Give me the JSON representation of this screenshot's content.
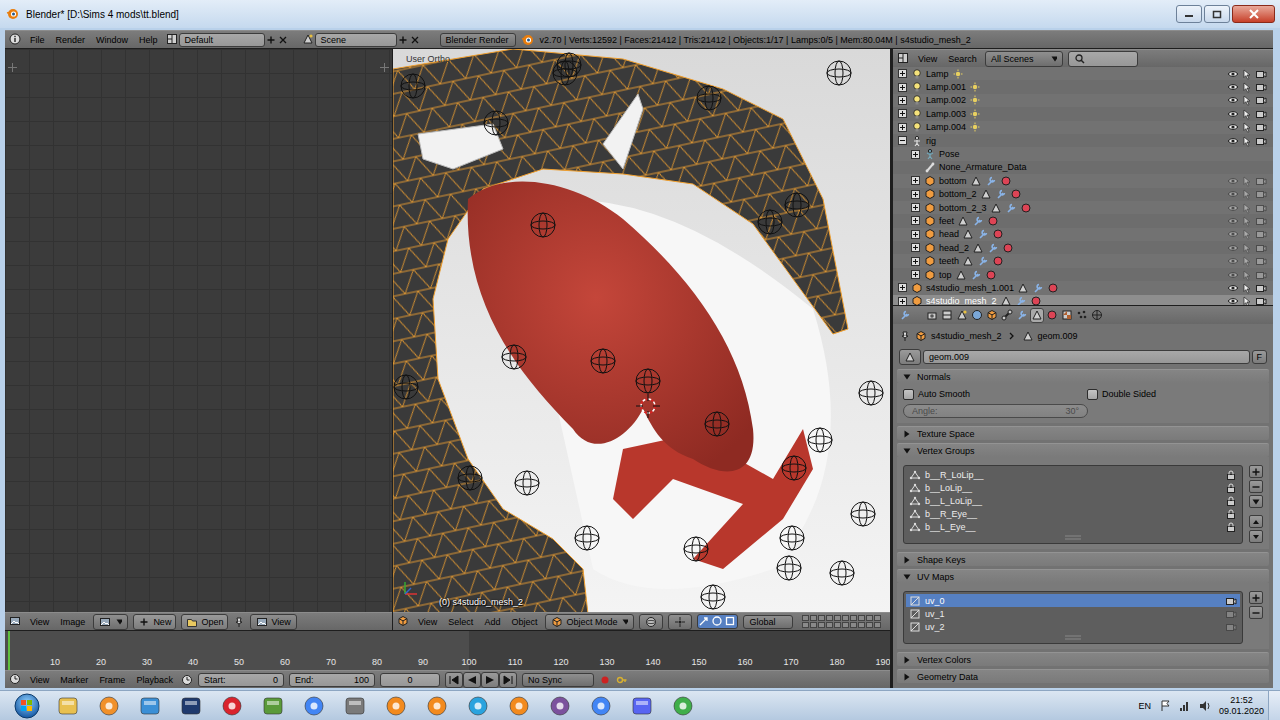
{
  "window": {
    "title": "Blender* [D:\\Sims 4 mods\\tt.blend]"
  },
  "info_header": {
    "menus": [
      "File",
      "Render",
      "Window",
      "Help"
    ],
    "layout": "Default",
    "scene": "Scene",
    "engine": "Blender Render",
    "stats": "v2.70 | Verts:12592 | Faces:21412 | Tris:21412 | Objects:1/17 | Lamps:0/5 | Mem:80.04M | s4studio_mesh_2"
  },
  "image_editor": {
    "menus": [
      "View",
      "Image"
    ],
    "buttons": [
      "New",
      "Open"
    ],
    "view_menu": "View"
  },
  "viewport": {
    "view_label": "User Ortho",
    "object_label": "(0) s4studio_mesh_2",
    "menus": [
      "View",
      "Select",
      "Add",
      "Object"
    ],
    "mode": "Object Mode",
    "orientation": "Global"
  },
  "outliner": {
    "menus": [
      "View",
      "Search"
    ],
    "filter": "All Scenes",
    "items": [
      {
        "label": "Lamp",
        "kind": "lamp",
        "depth": 1,
        "has_children": true,
        "expanded": false,
        "selected": false
      },
      {
        "label": "Lamp.001",
        "kind": "lamp",
        "depth": 1,
        "has_children": true,
        "expanded": false,
        "selected": false
      },
      {
        "label": "Lamp.002",
        "kind": "lamp",
        "depth": 1,
        "has_children": true,
        "expanded": false,
        "selected": false
      },
      {
        "label": "Lamp.003",
        "kind": "lamp",
        "depth": 1,
        "has_children": true,
        "expanded": false,
        "selected": false
      },
      {
        "label": "Lamp.004",
        "kind": "lamp",
        "depth": 1,
        "has_children": true,
        "expanded": false,
        "selected": false
      },
      {
        "label": "rig",
        "kind": "armature",
        "depth": 1,
        "has_children": true,
        "expanded": true,
        "selected": false
      },
      {
        "label": "Pose",
        "kind": "pose",
        "depth": 2,
        "has_children": true,
        "expanded": false,
        "selected": false
      },
      {
        "label": "None_Armature_Data",
        "kind": "armature-data",
        "depth": 2,
        "has_children": false,
        "expanded": false,
        "selected": false
      },
      {
        "label": "bottom",
        "kind": "mesh",
        "depth": 2,
        "has_children": true,
        "expanded": false,
        "selected": false
      },
      {
        "label": "bottom_2",
        "kind": "mesh",
        "depth": 2,
        "has_children": true,
        "expanded": false,
        "selected": false
      },
      {
        "label": "bottom_2_3",
        "kind": "mesh",
        "depth": 2,
        "has_children": true,
        "expanded": false,
        "selected": false
      },
      {
        "label": "feet",
        "kind": "mesh",
        "depth": 2,
        "has_children": true,
        "expanded": false,
        "selected": false
      },
      {
        "label": "head",
        "kind": "mesh",
        "depth": 2,
        "has_children": true,
        "expanded": false,
        "selected": false
      },
      {
        "label": "head_2",
        "kind": "mesh",
        "depth": 2,
        "has_children": true,
        "expanded": false,
        "selected": false
      },
      {
        "label": "teeth",
        "kind": "mesh",
        "depth": 2,
        "has_children": true,
        "expanded": false,
        "selected": false
      },
      {
        "label": "top",
        "kind": "mesh",
        "depth": 2,
        "has_children": true,
        "expanded": false,
        "selected": false
      },
      {
        "label": "s4studio_mesh_1.001",
        "kind": "mesh",
        "depth": 1,
        "has_children": true,
        "expanded": false,
        "selected": false
      },
      {
        "label": "s4studio_mesh_2",
        "kind": "mesh",
        "depth": 1,
        "has_children": true,
        "expanded": false,
        "selected": true
      }
    ]
  },
  "properties": {
    "tabs": [
      {
        "kind": "render",
        "selected": false
      },
      {
        "kind": "render-layers",
        "selected": false
      },
      {
        "kind": "scene",
        "selected": false
      },
      {
        "kind": "world",
        "selected": false
      },
      {
        "kind": "object",
        "selected": false
      },
      {
        "kind": "constraints",
        "selected": false
      },
      {
        "kind": "modifiers",
        "selected": false
      },
      {
        "kind": "data",
        "selected": true
      },
      {
        "kind": "material",
        "selected": false
      },
      {
        "kind": "texture",
        "selected": false
      },
      {
        "kind": "particles",
        "selected": false
      },
      {
        "kind": "physics",
        "selected": false
      }
    ],
    "breadcrumb": [
      "s4studio_mesh_2",
      "geom.009"
    ],
    "datablock": "geom.009",
    "fake_user": "F",
    "panels": [
      {
        "label": "Normals",
        "kind": "normals",
        "expanded": true,
        "options": [
          {
            "label": "Auto Smooth",
            "checked": false
          },
          {
            "label": "Double Sided",
            "checked": false
          }
        ],
        "angle": {
          "label": "Angle:",
          "value": "30°",
          "disabled": true
        }
      },
      {
        "label": "Texture Space",
        "kind": "header",
        "expanded": false
      },
      {
        "label": "Vertex Groups",
        "kind": "list",
        "expanded": true,
        "items": [
          {
            "label": "b__R_LoLip__",
            "selected": false
          },
          {
            "label": "b__LoLip__",
            "selected": false
          },
          {
            "label": "b__L_LoLip__",
            "selected": false
          },
          {
            "label": "b__R_Eye__",
            "selected": false
          },
          {
            "label": "b__L_Eye__",
            "selected": false
          }
        ]
      },
      {
        "label": "Shape Keys",
        "kind": "header",
        "expanded": false
      },
      {
        "label": "UV Maps",
        "kind": "list",
        "expanded": true,
        "items": [
          {
            "label": "uv_0",
            "selected": true
          },
          {
            "label": "uv_1",
            "selected": false
          },
          {
            "label": "uv_2",
            "selected": false
          }
        ]
      },
      {
        "label": "Vertex Colors",
        "kind": "header",
        "expanded": false
      },
      {
        "label": "Geometry Data",
        "kind": "header",
        "expanded": false
      }
    ]
  },
  "timeline": {
    "ticks": [
      "10",
      "20",
      "30",
      "40",
      "50",
      "60",
      "70",
      "80",
      "90",
      "100",
      "110",
      "120",
      "130",
      "140",
      "150",
      "160",
      "170",
      "180",
      "190"
    ],
    "menus": [
      "View",
      "Marker",
      "Frame",
      "Playback"
    ],
    "start_label": "Start:",
    "start": "0",
    "end_label": "End:",
    "end": "100",
    "frame": "0",
    "sync": "No Sync"
  },
  "taskbar": {
    "language": "EN",
    "time": "21:52",
    "date": "09.01.2020"
  }
}
